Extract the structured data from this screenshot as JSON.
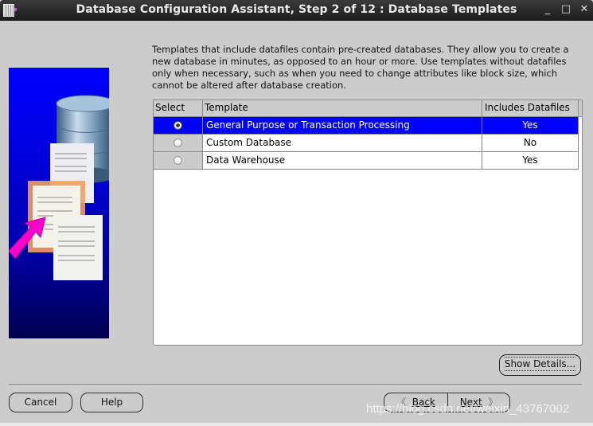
{
  "window": {
    "title": "Database Configuration Assistant, Step 2 of 12 : Database Templates",
    "controls": {
      "minimize": "_",
      "maximize": "□",
      "close": "✕"
    }
  },
  "description": "Templates that include datafiles contain pre-created databases. They allow you to create a new database in minutes, as opposed to an hour or more. Use templates without datafiles only when necessary, such as when you need to change attributes like block size, which cannot be altered after database creation.",
  "table": {
    "headers": {
      "select": "Select",
      "template": "Template",
      "includes": "Includes Datafiles"
    },
    "rows": [
      {
        "template": "General Purpose or Transaction Processing",
        "includes": "Yes",
        "selected": true
      },
      {
        "template": "Custom Database",
        "includes": "No",
        "selected": false
      },
      {
        "template": "Data Warehouse",
        "includes": "Yes",
        "selected": false
      }
    ]
  },
  "buttons": {
    "show_details": "Show Details...",
    "cancel": "Cancel",
    "help": "Help",
    "back": "Back",
    "next": "Next"
  },
  "colors": {
    "selection": "#0000ff",
    "background": "#cccccc"
  },
  "watermark": "https://blog.csdn.net/weixin_43767002"
}
